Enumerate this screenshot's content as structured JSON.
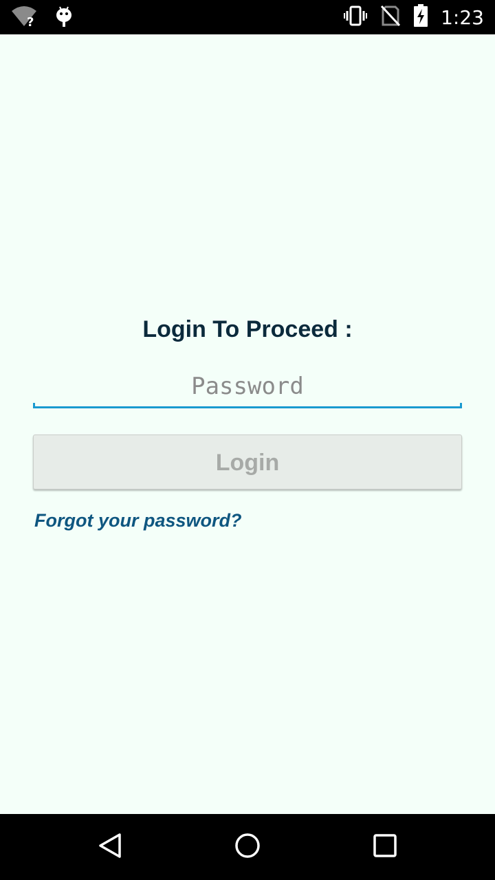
{
  "status_bar": {
    "time": "1:23",
    "icons": [
      "wifi-unknown-icon",
      "android-debug-icon",
      "vibrate-icon",
      "no-sim-icon",
      "battery-charging-icon"
    ]
  },
  "login": {
    "title": "Login To Proceed :",
    "password_placeholder": "Password",
    "password_value": "",
    "login_label": "Login",
    "forgot_label": "Forgot your password?"
  },
  "nav": {
    "icons": [
      "back-icon",
      "home-icon",
      "recents-icon"
    ]
  },
  "colors": {
    "background": "#f4fff9",
    "title": "#0b2a3c",
    "accent": "#1a9ad0",
    "link": "#0e5680",
    "button_bg": "#e7ece8",
    "button_text_disabled": "#a7aaa7"
  }
}
